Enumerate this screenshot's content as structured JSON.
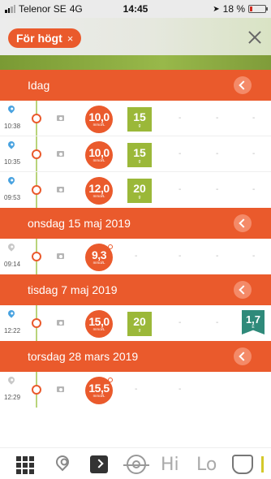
{
  "status_bar": {
    "carrier": "Telenor SE",
    "network": "4G",
    "time": "14:45",
    "battery": "18 %"
  },
  "filter": {
    "chip_label": "För högt",
    "chip_close": "×"
  },
  "colors": {
    "accent": "#ea5a2c",
    "carbs": "#9bb839",
    "note": "#2f8a7a",
    "timeline": "#b9d47a",
    "pin": "#4aa3e0"
  },
  "sections": [
    {
      "title": "Idag",
      "rows": [
        {
          "time": "10:38",
          "pin": "blue",
          "glucose": "10,0",
          "unit": "mmol/L",
          "carbs": "15",
          "carbs_unit": "g"
        },
        {
          "time": "10:35",
          "pin": "blue",
          "glucose": "10,0",
          "unit": "mmol/L",
          "carbs": "15",
          "carbs_unit": "g"
        },
        {
          "time": "09:53",
          "pin": "blue",
          "glucose": "12,0",
          "unit": "mmol/L",
          "carbs": "20",
          "carbs_unit": "g"
        }
      ]
    },
    {
      "title": "onsdag 15 maj 2019",
      "rows": [
        {
          "time": "09:14",
          "pin": "gray",
          "glucose": "9,3",
          "unit": "mmol/L"
        }
      ]
    },
    {
      "title": "tisdag 7 maj 2019",
      "rows": [
        {
          "time": "12:22",
          "pin": "blue",
          "glucose": "15,0",
          "unit": "mmol/L",
          "carbs": "20",
          "carbs_unit": "g",
          "extra": "1,7",
          "extra_unit": "E"
        }
      ]
    },
    {
      "title": "torsdag 28 mars 2019",
      "rows": [
        {
          "time": "12:29",
          "pin": "gray",
          "glucose": "15,5",
          "unit": "mmol/L"
        }
      ]
    }
  ],
  "dash": "-",
  "tabbar": {
    "hi_label": "Hi",
    "lo_label": "Lo",
    "icons": [
      "grid-icon",
      "map-pin-icon",
      "logbook-icon",
      "target-icon",
      "hi-icon",
      "lo-icon",
      "food-icon",
      "fork-icon"
    ]
  }
}
